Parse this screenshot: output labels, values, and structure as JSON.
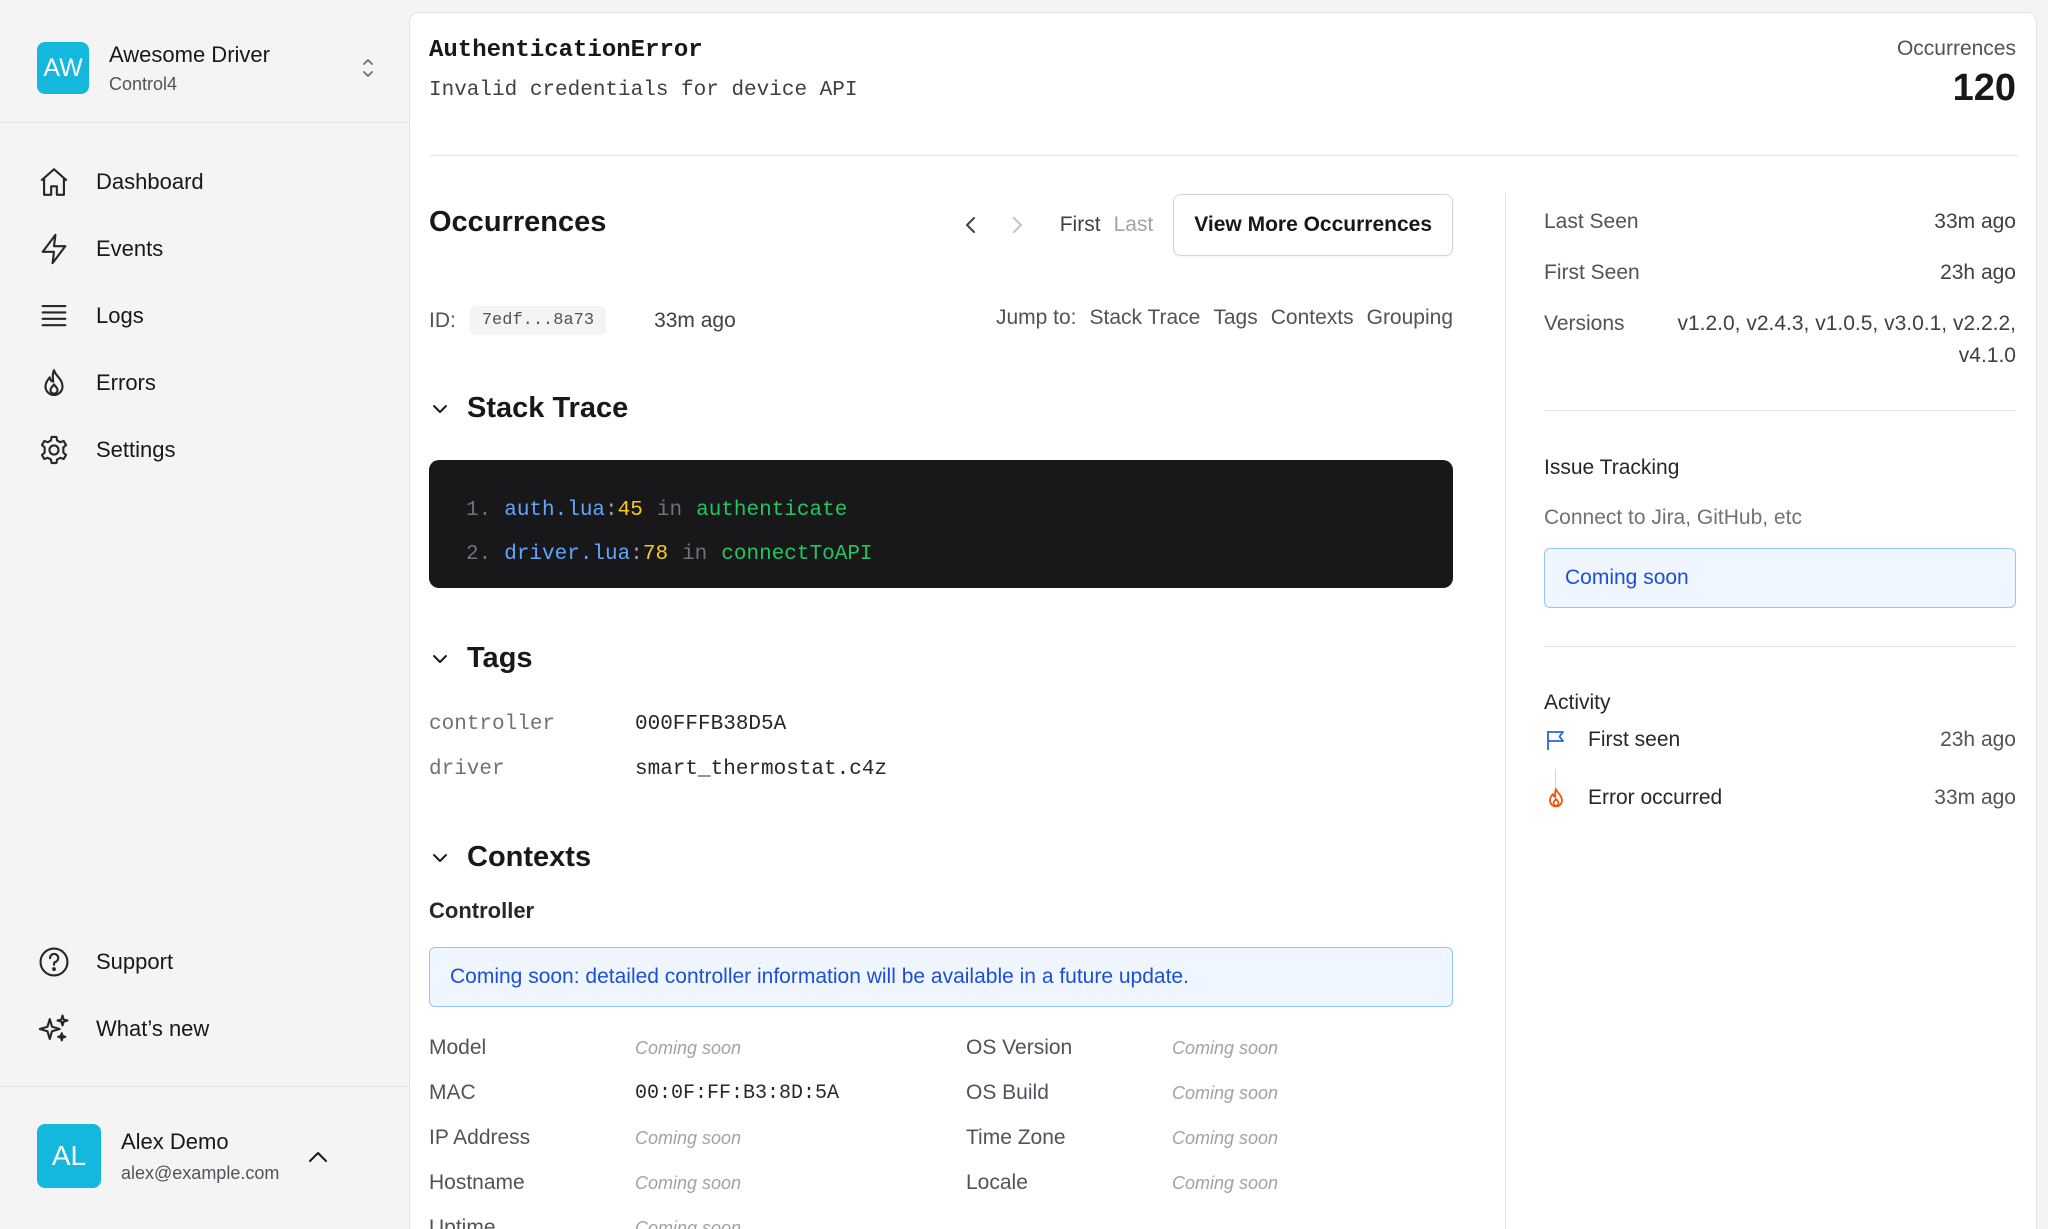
{
  "team": {
    "initials": "AW",
    "name": "Awesome Driver",
    "platform": "Control4"
  },
  "nav": [
    {
      "id": "dashboard",
      "label": "Dashboard",
      "icon": "home-icon"
    },
    {
      "id": "events",
      "label": "Events",
      "icon": "bolt-icon"
    },
    {
      "id": "logs",
      "label": "Logs",
      "icon": "list-icon"
    },
    {
      "id": "errors",
      "label": "Errors",
      "icon": "flame-icon"
    },
    {
      "id": "settings",
      "label": "Settings",
      "icon": "gear-icon"
    }
  ],
  "nav_bottom": [
    {
      "id": "support",
      "label": "Support",
      "icon": "question-icon"
    },
    {
      "id": "whats-new",
      "label": "What’s new",
      "icon": "sparkles-icon"
    }
  ],
  "user": {
    "initials": "AL",
    "name": "Alex Demo",
    "email": "alex@example.com"
  },
  "error": {
    "title": "AuthenticationError",
    "message": "Invalid credentials for device API"
  },
  "occurrences": {
    "label": "Occurrences",
    "count": "120"
  },
  "occurrence_section": {
    "title": "Occurrences",
    "first": "First",
    "last": "Last",
    "view_more": "View More Occurrences",
    "id_label": "ID:",
    "id_value": "7edf...8a73",
    "ago": "33m ago",
    "jump_label": "Jump to:",
    "jump_links": [
      "Stack Trace",
      "Tags",
      "Contexts",
      "Grouping"
    ]
  },
  "stack_trace": {
    "title": "Stack Trace",
    "frames": [
      {
        "num": "1.",
        "file": "auth.lua",
        "line": "45",
        "in": "in",
        "fn": "authenticate"
      },
      {
        "num": "2.",
        "file": "driver.lua",
        "line": "78",
        "in": "in",
        "fn": "connectToAPI"
      }
    ]
  },
  "tags": {
    "title": "Tags",
    "items": [
      {
        "key": "controller",
        "value": "000FFFB38D5A"
      },
      {
        "key": "driver",
        "value": "smart_thermostat.c4z"
      }
    ]
  },
  "contexts": {
    "title": "Contexts",
    "controller_title": "Controller",
    "notice": "Coming soon: detailed controller information will be available in a future update.",
    "left": [
      {
        "key": "Model",
        "value": "Coming soon",
        "real": false
      },
      {
        "key": "MAC",
        "value": "00:0F:FF:B3:8D:5A",
        "real": true
      },
      {
        "key": "IP Address",
        "value": "Coming soon",
        "real": false
      },
      {
        "key": "Hostname",
        "value": "Coming soon",
        "real": false
      },
      {
        "key": "Uptime",
        "value": "Coming soon",
        "real": false
      }
    ],
    "right": [
      {
        "key": "OS Version",
        "value": "Coming soon"
      },
      {
        "key": "OS Build",
        "value": "Coming soon"
      },
      {
        "key": "Time Zone",
        "value": "Coming soon"
      },
      {
        "key": "Locale",
        "value": "Coming soon"
      }
    ]
  },
  "summary": {
    "last_seen_label": "Last Seen",
    "last_seen": "33m ago",
    "first_seen_label": "First Seen",
    "first_seen": "23h ago",
    "versions_label": "Versions",
    "versions_line1": "v1.2.0, v2.4.3, v1.0.5, v3.0.1, v2.2.2,",
    "versions_line2": "v4.1.0"
  },
  "issue_tracking": {
    "title": "Issue Tracking",
    "desc": "Connect to Jira, GitHub, etc",
    "status": "Coming soon"
  },
  "activity": {
    "title": "Activity",
    "items": [
      {
        "label": "First seen",
        "time": "23h ago",
        "icon": "flag-icon"
      },
      {
        "label": "Error occurred",
        "time": "33m ago",
        "icon": "flame-icon"
      }
    ]
  },
  "colors": {
    "accent": "#14b8dc",
    "link_blue": "#1d4ed8",
    "code_bg": "#18181b",
    "flame": "#ea580c"
  }
}
